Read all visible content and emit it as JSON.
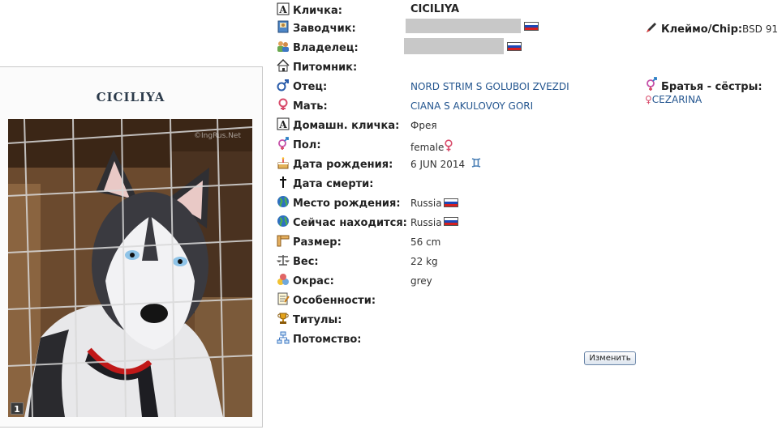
{
  "dog": {
    "name": "CICILIYA",
    "photo_watermark": "©IngRus.Net",
    "photo_index": "1"
  },
  "colors": {
    "link": "#23558f",
    "female_symbol": "#d84a6a"
  },
  "fields": {
    "nickname": {
      "label": "Кличка:",
      "value": "CICILIYA",
      "icon": "letter-a-icon"
    },
    "breeder": {
      "label": "Заводчик:",
      "icon": "breeder-book-icon",
      "flag": "russia-flag-icon"
    },
    "owner": {
      "label": "Владелец:",
      "icon": "owners-people-icon",
      "flag": "russia-flag-icon"
    },
    "kennel": {
      "label": "Питомник:",
      "icon": "house-icon"
    },
    "father": {
      "label": "Отец:",
      "value": "NORD STRIM S GOLUBOI ZVEZDI",
      "icon": "male-symbol-icon"
    },
    "mother": {
      "label": "Мать:",
      "value": "CIANA S AKULOVOY GORI",
      "icon": "female-symbol-icon"
    },
    "home_name": {
      "label": "Домашн. кличка:",
      "value": "Фрея",
      "icon": "letter-a-icon"
    },
    "sex": {
      "label": "Пол:",
      "value": "female",
      "icon": "gender-symbol-icon"
    },
    "birth_date": {
      "label": "Дата рождения:",
      "value": "6 JUN 2014",
      "icon": "birthday-cake-icon",
      "zodiac": "gemini-icon"
    },
    "death_date": {
      "label": "Дата смерти:",
      "icon": "cross-icon"
    },
    "birth_place": {
      "label": "Место рождения:",
      "value": "Russia",
      "icon": "globe-icon",
      "flag": "russia-flag-icon"
    },
    "current_place": {
      "label": "Сейчас находится:",
      "value": "Russia",
      "icon": "globe-icon",
      "flag": "russia-flag-icon"
    },
    "size": {
      "label": "Размер:",
      "value": "56 cm",
      "icon": "ruler-icon"
    },
    "weight": {
      "label": "Вес:",
      "value": "22 kg",
      "icon": "scales-icon"
    },
    "color": {
      "label": "Окрас:",
      "value": "grey",
      "icon": "color-balls-icon"
    },
    "features": {
      "label": "Особенности:",
      "icon": "notepad-icon"
    },
    "titles": {
      "label": "Титулы:",
      "icon": "trophy-icon"
    },
    "offspring": {
      "label": "Потомство:",
      "icon": "family-tree-icon"
    }
  },
  "chip": {
    "label": "Клеймо/Chip:",
    "value": "BSD 91",
    "icon": "pen-icon"
  },
  "siblings": {
    "label": "Братья - сёстры:",
    "icon": "gender-symbol-icon",
    "items": [
      "CEZARINA"
    ]
  },
  "edit_button": "Изменить"
}
